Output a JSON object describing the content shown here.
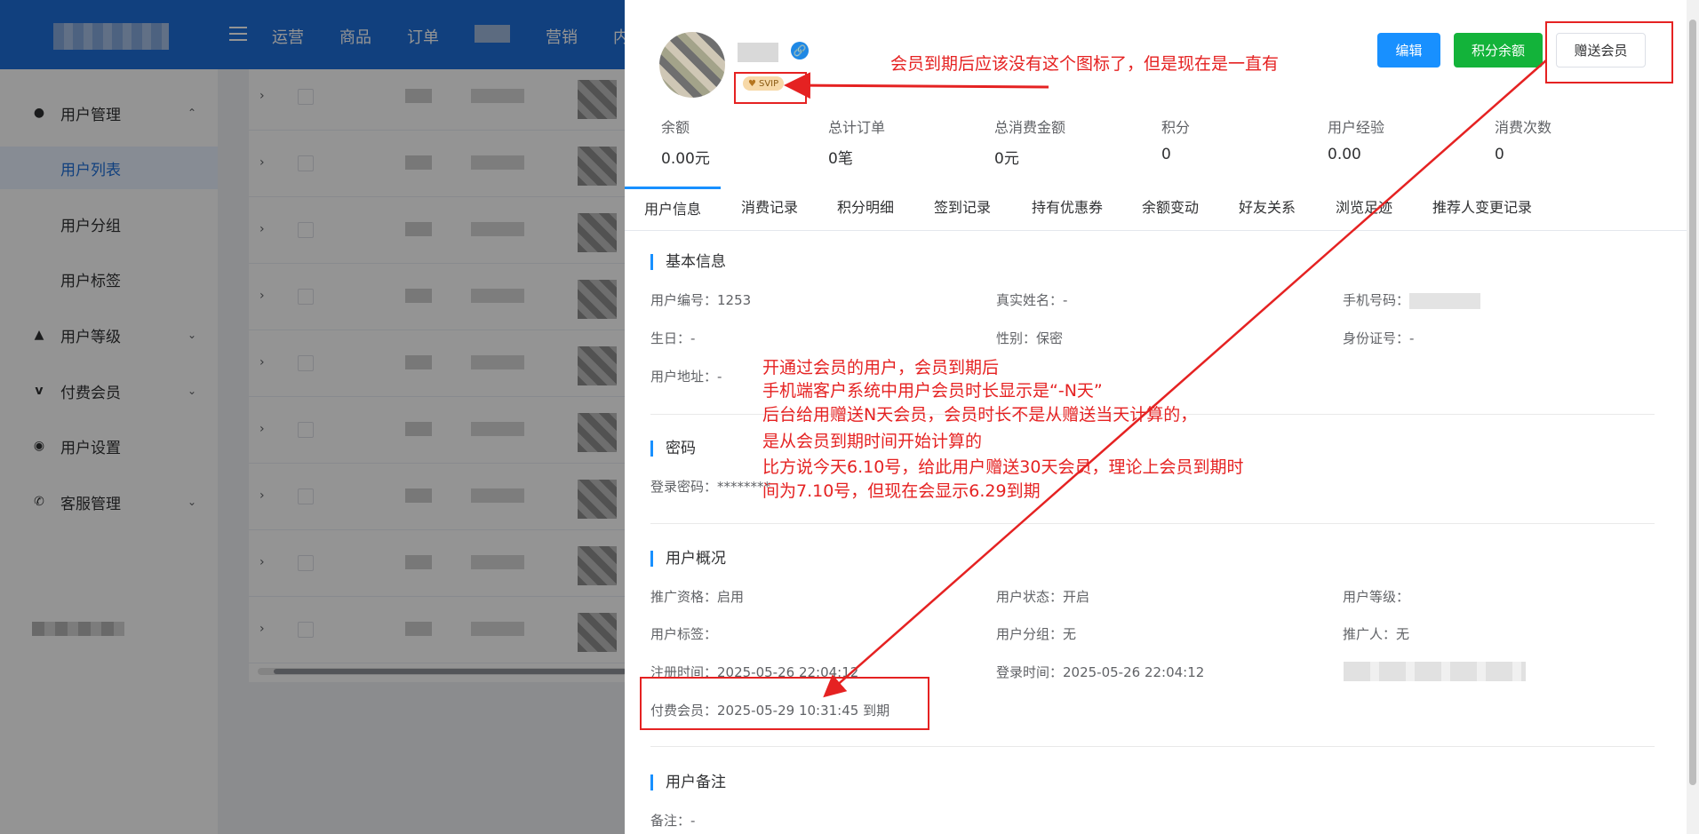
{
  "topnav": {
    "items": [
      "运营",
      "商品",
      "订单",
      "营销",
      "内"
    ]
  },
  "sidebar": {
    "user_mgmt": "用户管理",
    "user_list": "用户列表",
    "user_group": "用户分组",
    "user_tag": "用户标签",
    "user_level": "用户等级",
    "paid_member": "付费会员",
    "user_settings": "用户设置",
    "service_mgmt": "客服管理"
  },
  "profile": {
    "badge": "SVIP",
    "buttons": {
      "edit": "编辑",
      "points_balance": "积分余额",
      "gift_member": "赠送会员"
    },
    "stats": [
      {
        "label": "余额",
        "value": "0.00元"
      },
      {
        "label": "总计订单",
        "value": "0笔"
      },
      {
        "label": "总消费金额",
        "value": "0元"
      },
      {
        "label": "积分",
        "value": "0"
      },
      {
        "label": "用户经验",
        "value": "0.00"
      },
      {
        "label": "消费次数",
        "value": "0"
      }
    ]
  },
  "tabs": [
    "用户信息",
    "消费记录",
    "积分明细",
    "签到记录",
    "持有优惠券",
    "余额变动",
    "好友关系",
    "浏览足迹",
    "推荐人变更记录"
  ],
  "basic": {
    "title": "基本信息",
    "user_id": "用户编号：1253",
    "real_name": "真实姓名：-",
    "phone_label": "手机号码：",
    "birthday": "生日：-",
    "gender": "性别：保密",
    "id_card": "身份证号：-",
    "address": "用户地址：-"
  },
  "password": {
    "title": "密码",
    "login_password": "登录密码：********"
  },
  "overview": {
    "title": "用户概况",
    "promo": "推广资格：启用",
    "status": "用户状态：开启",
    "level": "用户等级：",
    "tags": "用户标签：",
    "group": "用户分组：无",
    "referrer": "推广人：无",
    "register_time": "注册时间：2025-05-26 22:04:12",
    "login_time": "登录时间：2025-05-26 22:04:12",
    "paid_member": "付费会员：2025-05-29 10:31:45 到期"
  },
  "remark": {
    "title": "用户备注",
    "note": "备注：-"
  },
  "annotations": {
    "top": "会员到期后应该没有这个图标了，但是现在是一直有",
    "middle": [
      "开通过会员的用户，会员到期后",
      "手机端客户系统中用户会员时长显示是“-N天”",
      "后台给用赠送N天会员，会员时长不是从赠送当天计算的，",
      "是从会员到期时间开始计算的",
      "比方说今天6.10号，给此用户赠送30天会员，理论上会员到期时",
      "间为7.10号，但现在会显示6.29到期"
    ]
  },
  "colors": {
    "primary": "#1890ff",
    "success": "#13b33a",
    "annotation_red": "#e52222",
    "header_blue": "#1e6fd9"
  }
}
